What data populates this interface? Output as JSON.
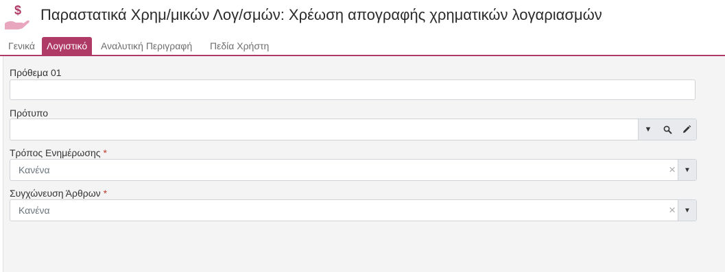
{
  "header": {
    "title": "Παραστατικά Χρημ/μικών Λογ/σμών: Χρέωση απογραφής χρηματικών λογαριασμών",
    "icon": "money-hand-icon",
    "accent_color": "#b03a66"
  },
  "tabs": [
    {
      "label": "Γενικά",
      "active": false
    },
    {
      "label": "Λογιστικό",
      "active": true
    },
    {
      "label": "Αναλυτική Περιγραφή",
      "active": false
    },
    {
      "label": "Πεδία Χρήστη",
      "active": false
    }
  ],
  "form": {
    "prefix": {
      "label": "Πρόθεμα 01",
      "value": ""
    },
    "template": {
      "label": "Πρότυπο",
      "value": ""
    },
    "update_mode": {
      "label": "Τρόπος Ενημέρωσης",
      "required_mark": "*",
      "value": "Κανένα"
    },
    "merge_entries": {
      "label": "Συγχώνευση Άρθρων",
      "required_mark": "*",
      "value": "Κανένα"
    }
  }
}
